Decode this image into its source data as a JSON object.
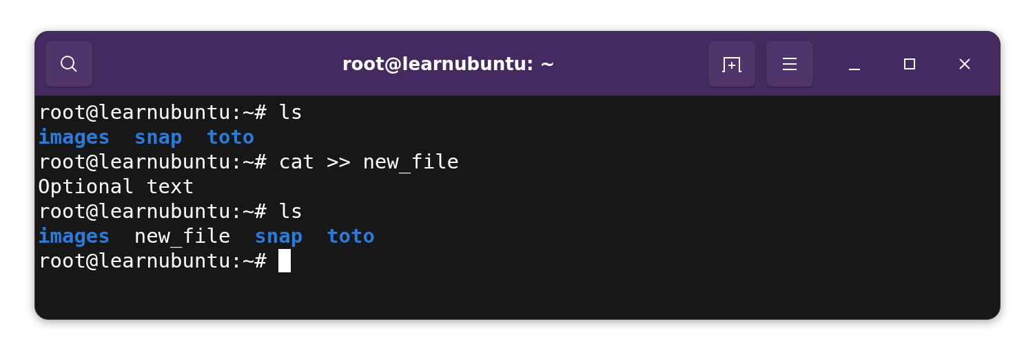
{
  "window": {
    "title": "root@learnubuntu: ~"
  },
  "terminal": {
    "lines": [
      {
        "segments": [
          {
            "kind": "plain",
            "text": "root@learnubuntu:~# ls"
          }
        ]
      },
      {
        "segments": [
          {
            "kind": "dir",
            "text": "images"
          },
          {
            "kind": "dir",
            "text": "snap"
          },
          {
            "kind": "dir",
            "text": "toto"
          }
        ]
      },
      {
        "segments": [
          {
            "kind": "plain",
            "text": "root@learnubuntu:~# cat >> new_file"
          }
        ]
      },
      {
        "segments": [
          {
            "kind": "plain",
            "text": "Optional text"
          }
        ]
      },
      {
        "segments": [
          {
            "kind": "plain",
            "text": "root@learnubuntu:~# ls"
          }
        ]
      },
      {
        "segments": [
          {
            "kind": "dir",
            "text": "images"
          },
          {
            "kind": "plain",
            "text": "new_file"
          },
          {
            "kind": "dir",
            "text": "snap"
          },
          {
            "kind": "dir",
            "text": "toto"
          }
        ]
      },
      {
        "segments": [
          {
            "kind": "plain",
            "text": "root@learnubuntu:~#"
          }
        ],
        "cursor": true
      }
    ]
  }
}
